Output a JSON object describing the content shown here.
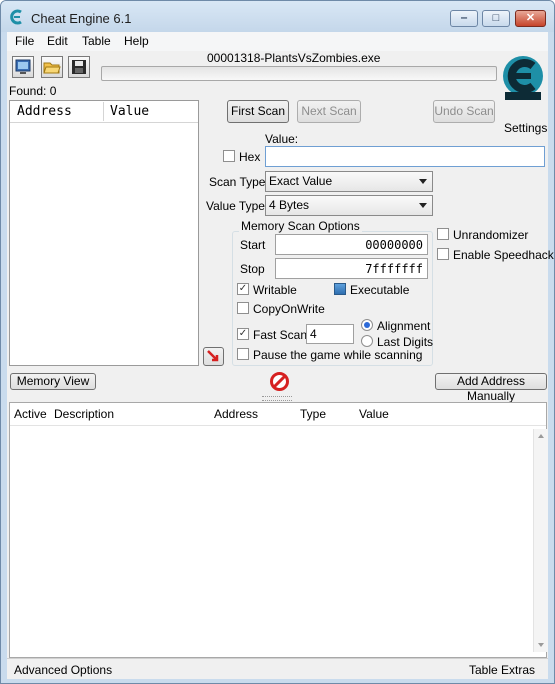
{
  "window": {
    "title": "Cheat Engine 6.1"
  },
  "menu": {
    "items": [
      "File",
      "Edit",
      "Table",
      "Help"
    ]
  },
  "toolbar": {
    "process_icon": "monitor-process-icon",
    "open_icon": "folder-open-icon",
    "save_icon": "floppy-save-icon"
  },
  "process": {
    "name": "00001318-PlantsVsZombies.exe",
    "progress": 0.0
  },
  "found": "Found: 0",
  "settings_label": "Settings",
  "address_list": {
    "columns": [
      "Address",
      "Value"
    ]
  },
  "scan": {
    "first_scan": "First Scan",
    "next_scan": "Next Scan",
    "undo_scan": "Undo Scan",
    "value_label": "Value:",
    "hex_label": "Hex",
    "value_input": "",
    "scan_type_label": "Scan Type",
    "scan_type": "Exact Value",
    "value_type_label": "Value Type",
    "value_type": "4 Bytes"
  },
  "memory_options": {
    "title": "Memory Scan Options",
    "start_label": "Start",
    "start": "00000000",
    "stop_label": "Stop",
    "stop": "7fffffff",
    "writable": "Writable",
    "executable": "Executable",
    "copy_on_write": "CopyOnWrite",
    "fast_scan": "Fast Scan",
    "fast_scan_value": "4",
    "alignment": "Alignment",
    "last_digits": "Last Digits",
    "pause_game": "Pause the game while scanning"
  },
  "extra_options": {
    "unrandomizer": "Unrandomizer",
    "speedhack": "Enable Speedhack"
  },
  "buttons": {
    "memory_view": "Memory View",
    "add_address": "Add Address Manually"
  },
  "cheat_table": {
    "columns": [
      "Active",
      "Description",
      "Address",
      "Type",
      "Value"
    ]
  },
  "status": {
    "advanced": "Advanced Options",
    "table_extras": "Table Extras"
  },
  "colors": {
    "titlebar": "#c9dbed",
    "accent_blue": "#2d6ad8",
    "logo_teal": "#1e8fa7",
    "stop_red": "#d62020"
  }
}
